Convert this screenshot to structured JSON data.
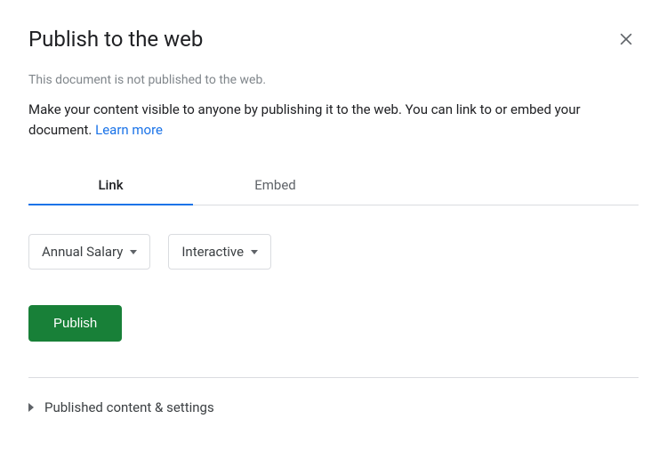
{
  "dialog": {
    "title": "Publish to the web",
    "status": "This document is not published to the web.",
    "description": "Make your content visible to anyone by publishing it to the web. You can link to or embed your document. ",
    "learn_more": "Learn more"
  },
  "tabs": {
    "link": "Link",
    "embed": "Embed"
  },
  "dropdowns": {
    "sheet": "Annual Salary",
    "mode": "Interactive"
  },
  "buttons": {
    "publish": "Publish"
  },
  "expandable": {
    "label": "Published content & settings"
  }
}
